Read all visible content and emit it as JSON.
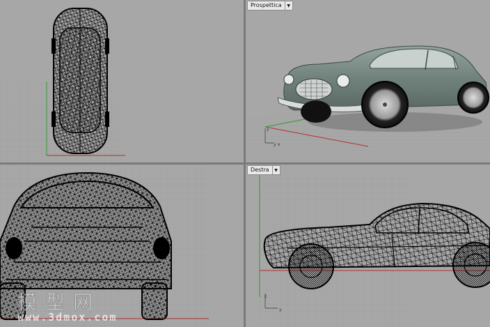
{
  "viewports": {
    "top": {
      "label": ""
    },
    "perspective": {
      "label": "Prospettica"
    },
    "front": {
      "label": ""
    },
    "right": {
      "label": "Destra"
    }
  },
  "axes": {
    "x": "x",
    "y": "y",
    "z": "z"
  },
  "watermark": {
    "brand_cn": "模型网",
    "url": "www.3dmox.com"
  },
  "icons": {
    "viewport_menu": "chevron-down-icon"
  },
  "colors": {
    "viewport_bg": "#a7a7a7",
    "grid_line": "#999999",
    "x_axis": "#b03030",
    "y_axis": "#2f9a2f",
    "car_body": "#7f8f8a",
    "wire": "#000000"
  }
}
